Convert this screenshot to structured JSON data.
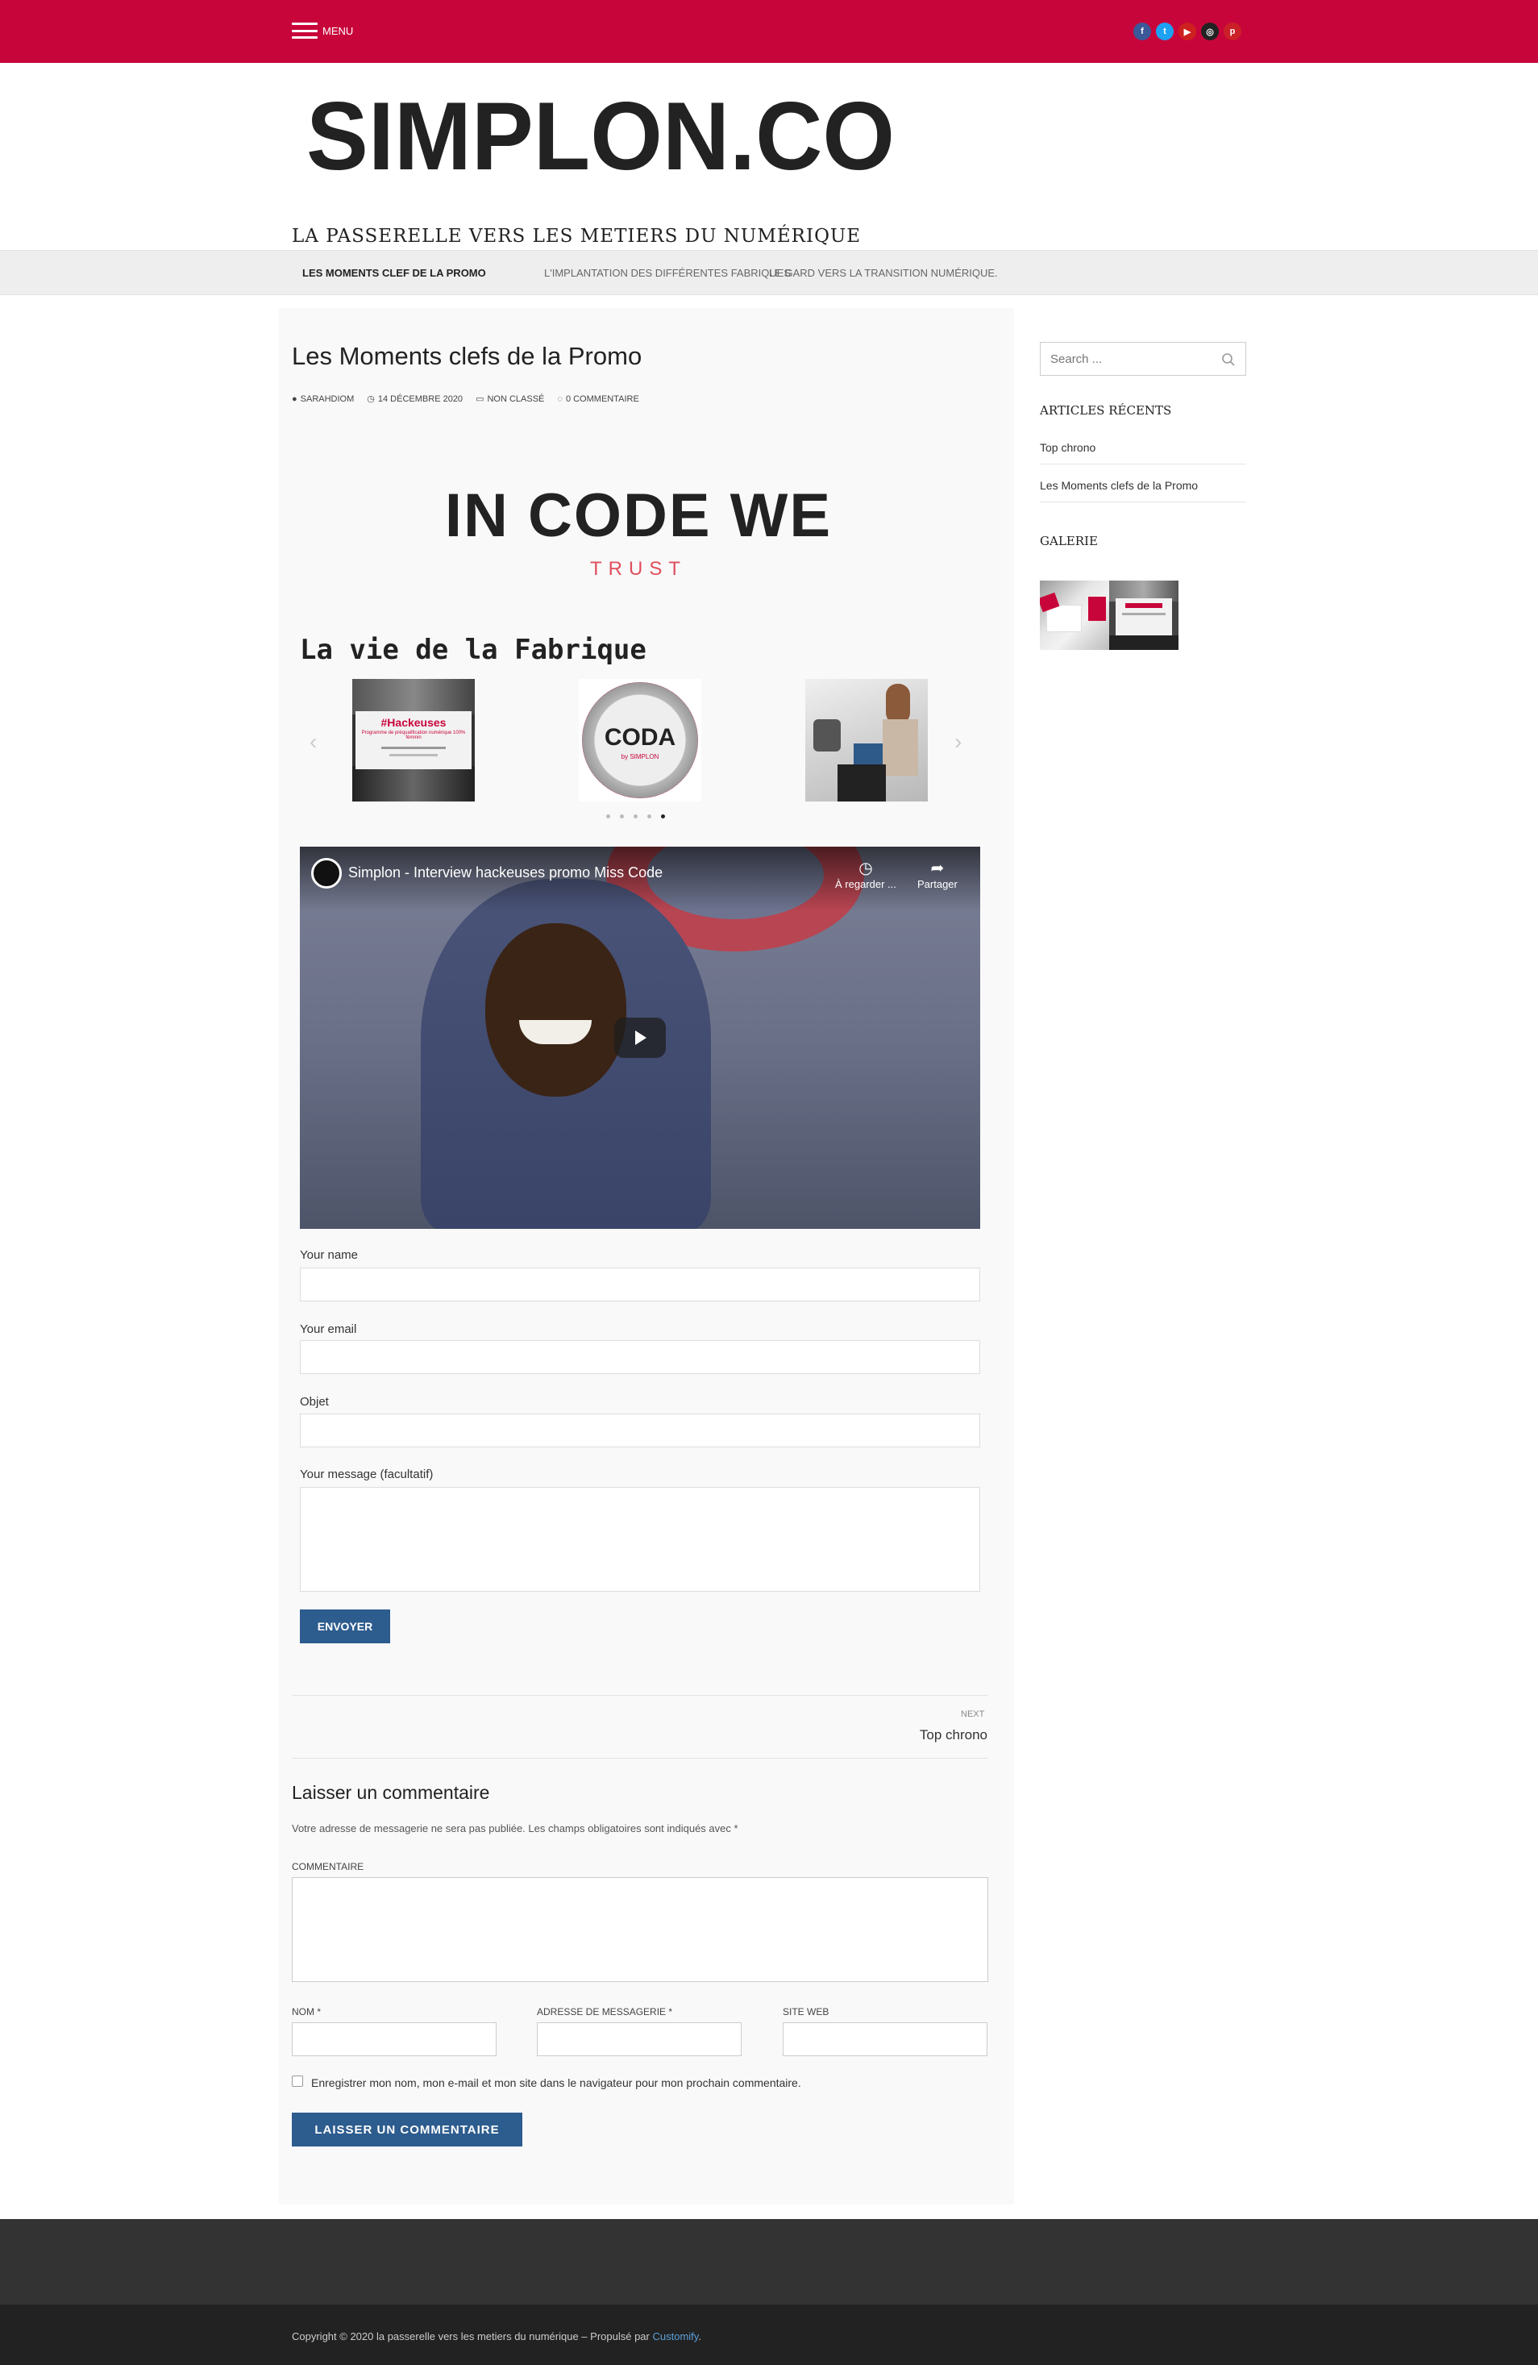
{
  "header": {
    "menu_label": "MENU",
    "socials": [
      {
        "icon": "facebook-icon",
        "color": "#3b5998",
        "glyph": "f"
      },
      {
        "icon": "twitter-icon",
        "color": "#1da1f2",
        "glyph": "t"
      },
      {
        "icon": "youtube-icon",
        "color": "#cd201f",
        "glyph": "▶"
      },
      {
        "icon": "instagram-icon",
        "color": "#222222",
        "glyph": "◎"
      },
      {
        "icon": "pinterest-icon",
        "color": "#cb2027",
        "glyph": "p"
      }
    ],
    "accent_color": "#c8053b"
  },
  "logo": {
    "text": "SIMPLON.CO"
  },
  "site": {
    "tagline": "LA PASSERELLE VERS LES METIERS DU NUMÉRIQUE"
  },
  "nav": {
    "items": [
      {
        "label": "LES MOMENTS CLEF DE LA PROMO",
        "active": true
      },
      {
        "label": "L'IMPLANTATION DES DIFFÉRENTES FABRIQUES",
        "active": false
      },
      {
        "label": "LE GARD VERS LA TRANSITION NUMÉRIQUE.",
        "active": false
      }
    ]
  },
  "post": {
    "title": "Les Moments clefs de la Promo",
    "author": "SARAHDIOM",
    "date": "14 DÉCEMBRE 2020",
    "category": "NON CLASSÉ",
    "comments": "0 COMMENTAIRE",
    "motto_main": "IN CODE WE",
    "motto_sub": "TRUST",
    "fabrique_title": "La vie de la Fabrique",
    "slides": {
      "hackeuses_title": "#Hackeuses",
      "hackeuses_sub": "Programme de préqualification numérique 100% féminin",
      "coda_text": "CODA",
      "coda_sub": "by SIMPLON"
    },
    "video": {
      "title": "Simplon - Interview hackeuses promo Miss Code",
      "watch_later": "À regarder ...",
      "share": "Partager"
    }
  },
  "contact_form": {
    "name_label": "Your name",
    "email_label": "Your email",
    "subject_label": "Objet",
    "message_label": "Your message (facultatif)",
    "submit_label": "ENVOYER"
  },
  "post_nav": {
    "next_label": "NEXT",
    "next_title": "Top chrono"
  },
  "comment_form": {
    "title": "Laisser un commentaire",
    "notice": "Votre adresse de messagerie ne sera pas publiée. Les champs obligatoires sont indiqués avec *",
    "comment_label": "COMMENTAIRE",
    "name_label": "NOM *",
    "email_label": "ADRESSE DE MESSAGERIE *",
    "website_label": "SITE WEB",
    "remember_label": "Enregistrer mon nom, mon e-mail et mon site dans le navigateur pour mon prochain commentaire.",
    "submit_label": "LAISSER UN COMMENTAIRE"
  },
  "sidebar": {
    "search_placeholder": "Search ...",
    "recent_title": "ARTICLES RÉCENTS",
    "recent_posts": [
      "Top chrono",
      "Les Moments clefs de la Promo"
    ],
    "gallery_title": "GALERIE"
  },
  "footer": {
    "copyright": "Copyright © 2020 la passerelle vers les metiers du numérique – Propulsé par ",
    "powered_by": "Customify",
    "powered_suffix": "."
  }
}
